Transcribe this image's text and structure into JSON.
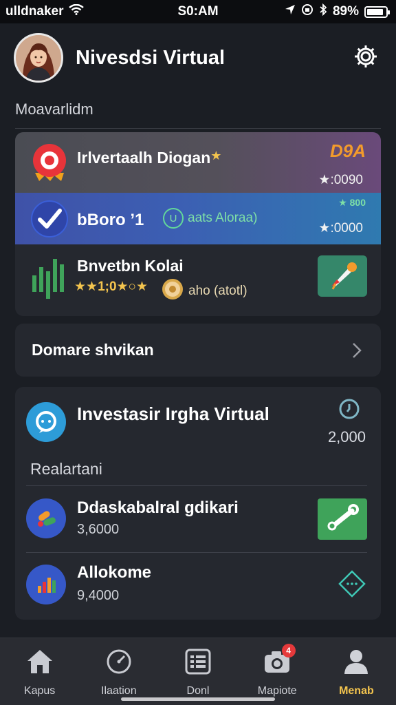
{
  "status_bar": {
    "carrier": "ulldnaker",
    "time": "S0:AM",
    "battery": "89%",
    "battery_level": 0.89
  },
  "header": {
    "title": "Nivesdsi Virtual"
  },
  "section": {
    "label": "Moavarlidm"
  },
  "investments": [
    {
      "title": "Irlvertaalh Diogan",
      "title_icon": "star-icon",
      "top_text": "D9A",
      "side_text": "★:0090",
      "icon": "target-icon"
    },
    {
      "title": "bBoro ’1",
      "pill_text": "aats Aloraa)",
      "pill_icon": "U",
      "top_text": "★ 800",
      "side_text": "★:0000",
      "icon": "checkmark-icon"
    },
    {
      "title": "Bnvetbn Kolai",
      "stars_text": "★★1;0★○★",
      "pill_text": "aho (atotl)",
      "icon": "bar-chart-icon",
      "action_icon": "rocket-icon"
    }
  ],
  "row_card": {
    "label": "Domare shvikan"
  },
  "virtual": {
    "title": "Investasir Irgha Virtual",
    "amount": "2,000",
    "section_label": "Realartani",
    "items": [
      {
        "title": "Ddaskabalral gdikari",
        "value": "3,6000",
        "icon": "pills-icon",
        "action_icon": "wrench-icon"
      },
      {
        "title": "Allokome",
        "value": "9,4000",
        "icon": "bar-chart-icon",
        "action_icon": "diamond-icon"
      }
    ]
  },
  "nav": [
    {
      "label": "Kapus",
      "icon": "home-icon"
    },
    {
      "label": "Ilaation",
      "icon": "gauge-icon"
    },
    {
      "label": "Donl",
      "icon": "list-icon"
    },
    {
      "label": "Mapiote",
      "icon": "camera-icon",
      "badge": "4"
    },
    {
      "label": "Menab",
      "icon": "user-icon",
      "active": true
    }
  ],
  "colors": {
    "accent": "#f3c44e",
    "background": "#1b1e24",
    "card": "#25282f",
    "green": "#3fa35a",
    "blue": "#3f52a8"
  }
}
